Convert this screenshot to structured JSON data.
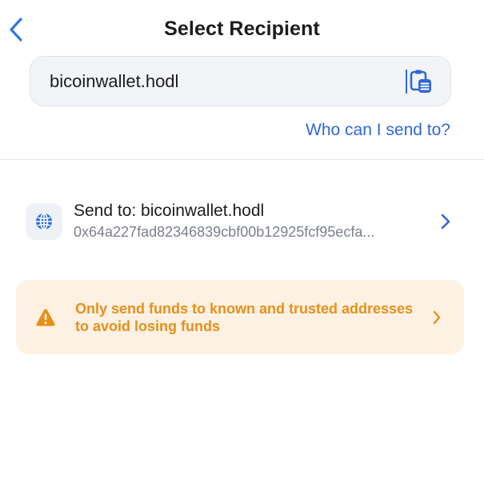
{
  "header": {
    "title": "Select Recipient",
    "back_icon": "chevron-left-icon"
  },
  "search": {
    "value": "bicoinwallet.hodl",
    "paste_icon": "clipboard-icon"
  },
  "help_link": "Who can I send to?",
  "recipient": {
    "icon": "globe-icon",
    "title": "Send to: bicoinwallet.hodl",
    "address": "0x64a227fad82346839cbf00b12925fcf95ecfa...",
    "chevron_icon": "chevron-right-icon"
  },
  "warning": {
    "icon": "warning-triangle-icon",
    "message": "Only send funds to known and trusted addresses to avoid losing funds",
    "chevron_icon": "chevron-right-icon"
  },
  "colors": {
    "accent": "#3167d6",
    "warning_text": "#e6901a",
    "warning_bg": "#fdf1e4"
  }
}
